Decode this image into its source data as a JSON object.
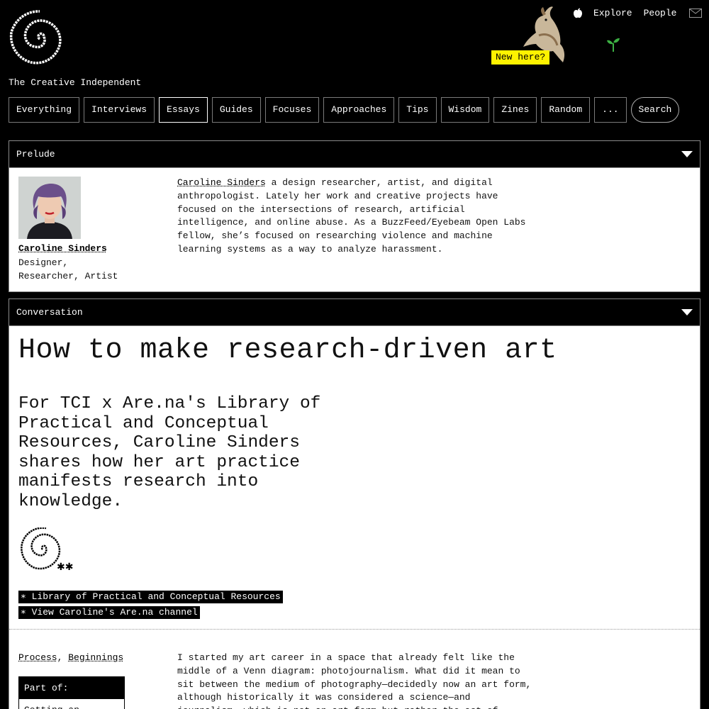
{
  "site": {
    "title": "The Creative Independent",
    "new_here": "New here?"
  },
  "topnav": {
    "explore": "Explore",
    "people": "People"
  },
  "categories": [
    {
      "label": "Everything"
    },
    {
      "label": "Interviews"
    },
    {
      "label": "Essays"
    },
    {
      "label": "Guides"
    },
    {
      "label": "Focuses"
    },
    {
      "label": "Approaches"
    },
    {
      "label": "Tips"
    },
    {
      "label": "Wisdom"
    },
    {
      "label": "Zines"
    },
    {
      "label": "Random"
    },
    {
      "label": "..."
    },
    {
      "label": "Search"
    }
  ],
  "active_category": "Essays",
  "prelude": {
    "header": "Prelude",
    "person_name": "Caroline Sinders",
    "person_role_line1": "Designer,",
    "person_role_line2": "Researcher, Artist",
    "bio_link": "Caroline Sinders",
    "bio_rest": " a design researcher, artist, and digital anthropologist. Lately her work and creative projects have focused on the intersections of research, artificial intelligence, and online abuse. As a BuzzFeed/Eyebeam Open Labs fellow, she’s focused on researching violence and machine learning systems as a way to analyze harassment."
  },
  "conversation": {
    "header": "Conversation",
    "headline": "How to make research-driven art",
    "dek": "For TCI x Are.na's Library of Practical and Conceptual Resources, Caroline Sinders shares how her art practice manifests research into knowledge.",
    "links": [
      {
        "label": "∗ Library of Practical and Conceptual Resources"
      },
      {
        "label": "∗ View Caroline's Are.na channel"
      }
    ],
    "topics": [
      "Process",
      "Beginnings"
    ],
    "part_of_header": "Part of:",
    "part_of_item": "Getting an",
    "body": "I started my art career in a space that already felt like the middle of a Venn diagram: photojournalism. What did it mean to sit between the medium of photography—decidedly now an art form, although historically it was considered a science—and journalism, which is not an art form but rather the act of researching"
  },
  "colors": {
    "highlight": "#fff200",
    "background": "#000000",
    "panel": "#ffffff"
  },
  "icons": [
    "spiral-logo-icon",
    "bird-icon",
    "apple-icon",
    "mail-icon",
    "sprout-icon",
    "caret-down-icon"
  ]
}
